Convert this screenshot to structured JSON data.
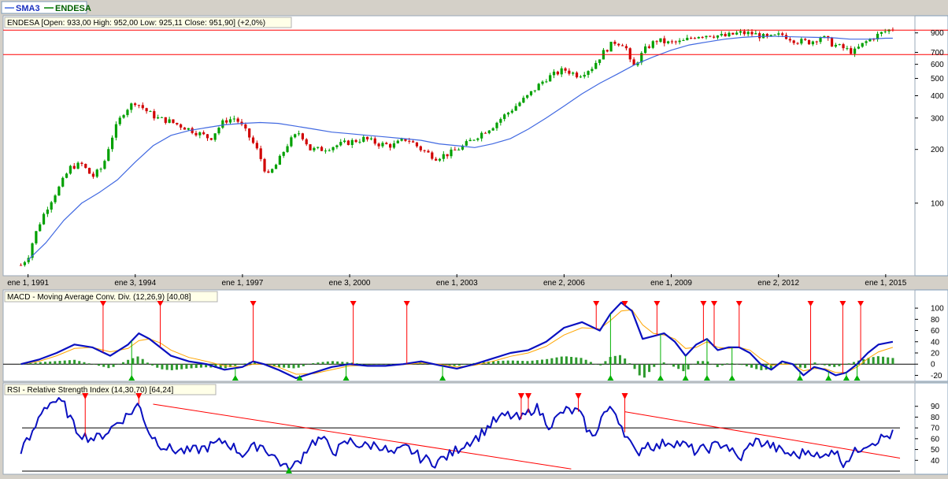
{
  "legend": {
    "items": [
      {
        "label": "SMA3",
        "color": "#4169e1"
      },
      {
        "label": "ENDESA",
        "color": "#008000"
      }
    ]
  },
  "colors": {
    "up": "#00a000",
    "down": "#d00000",
    "sma": "#4169e1",
    "macd_line": "#0a10c0",
    "signal_line": "#ffa500",
    "rsi_line": "#0a10c0",
    "trend_line": "#ff0000",
    "grid_border": "#7f9db9"
  },
  "price_panel": {
    "header": "ENDESA [Open: 933,00  High: 952,00  Low: 925,11  Close: 951,90] (+2,0%)",
    "scale": "log",
    "y_ticks": [
      "900",
      "700",
      "600",
      "500",
      "400",
      "300",
      "200",
      "100"
    ],
    "hlines": [
      933,
      680
    ],
    "x_ticks": [
      "ene 1, 1991",
      "ene 3, 1994",
      "ene 1, 1997",
      "ene 3, 2000",
      "ene 1, 2003",
      "ene 2, 2006",
      "ene 1, 2009",
      "ene 2, 2012",
      "ene 1, 2015"
    ]
  },
  "macd_panel": {
    "header": "MACD - Moving Average Conv. Div. (12,26,9) [40,08]",
    "y_ticks": [
      "100",
      "80",
      "60",
      "40",
      "20",
      "0",
      "-20"
    ]
  },
  "rsi_panel": {
    "header": "RSI - Relative Strength Index (14,30,70) [64,24]",
    "y_ticks": [
      "90",
      "80",
      "70",
      "60",
      "50",
      "40"
    ],
    "levels": [
      70,
      30
    ]
  },
  "chart_data": [
    {
      "type": "candlestick",
      "title": "ENDESA",
      "scale": "log",
      "x_range": [
        1990.7,
        2015.4
      ],
      "ylim": [
        40,
        1100
      ],
      "series": [
        {
          "name": "ENDESA",
          "kind": "close",
          "x": [
            1990.8,
            1991.0,
            1991.3,
            1991.6,
            1991.9,
            1992.2,
            1992.5,
            1992.8,
            1993.1,
            1993.4,
            1993.7,
            1994.0,
            1994.3,
            1994.6,
            1994.9,
            1995.3,
            1995.7,
            1996.1,
            1996.5,
            1996.8,
            1997.1,
            1997.4,
            1997.7,
            1998.0,
            1998.3,
            1998.6,
            1998.9,
            1999.2,
            1999.6,
            2000.0,
            2000.4,
            2000.8,
            2001.2,
            2001.6,
            2002.0,
            2002.4,
            2002.8,
            2003.2,
            2003.6,
            2004.0,
            2004.5,
            2005.0,
            2005.5,
            2006.0,
            2006.4,
            2006.8,
            2007.1,
            2007.4,
            2007.7,
            2007.9,
            2008.3,
            2008.6,
            2008.9,
            2009.3,
            2009.7,
            2010.1,
            2010.5,
            2010.9,
            2011.3,
            2011.7,
            2012.1,
            2012.5,
            2012.9,
            2013.2,
            2013.5,
            2013.8,
            2014.1,
            2014.4,
            2014.7,
            2015.0,
            2015.2
          ],
          "y": [
            45,
            50,
            75,
            100,
            125,
            160,
            165,
            140,
            160,
            250,
            330,
            370,
            330,
            300,
            290,
            270,
            250,
            230,
            290,
            300,
            250,
            200,
            140,
            170,
            220,
            250,
            200,
            200,
            210,
            220,
            230,
            215,
            210,
            230,
            200,
            180,
            190,
            210,
            240,
            270,
            330,
            400,
            500,
            560,
            520,
            580,
            700,
            800,
            780,
            560,
            740,
            820,
            790,
            800,
            870,
            880,
            860,
            900,
            890,
            840,
            880,
            810,
            800,
            860,
            780,
            740,
            700,
            790,
            860,
            920,
            950
          ]
        },
        {
          "name": "SMA3",
          "kind": "sma",
          "x": [
            1991.0,
            1991.5,
            1992.0,
            1992.5,
            1993.0,
            1993.5,
            1994.0,
            1994.5,
            1995.0,
            1995.5,
            1996.0,
            1996.5,
            1997.0,
            1997.5,
            1998.0,
            1998.5,
            1999.0,
            1999.5,
            2000.0,
            2000.5,
            2001.0,
            2001.5,
            2002.0,
            2002.5,
            2003.0,
            2003.5,
            2004.0,
            2004.5,
            2005.0,
            2005.5,
            2006.0,
            2006.5,
            2007.0,
            2007.5,
            2008.0,
            2008.5,
            2009.0,
            2009.5,
            2010.0,
            2010.5,
            2011.0,
            2011.5,
            2012.0,
            2012.5,
            2013.0,
            2013.5,
            2014.0,
            2014.5,
            2015.0,
            2015.2
          ],
          "y": [
            48,
            60,
            80,
            100,
            115,
            135,
            170,
            210,
            240,
            255,
            265,
            275,
            280,
            283,
            280,
            270,
            260,
            250,
            245,
            240,
            235,
            230,
            225,
            215,
            210,
            205,
            215,
            230,
            260,
            300,
            350,
            410,
            470,
            530,
            600,
            660,
            720,
            770,
            800,
            830,
            850,
            860,
            860,
            855,
            850,
            845,
            830,
            830,
            840,
            840
          ]
        }
      ]
    },
    {
      "type": "line",
      "title": "MACD - Moving Average Conv. Div. (12,26,9)",
      "ylim": [
        -25,
        110
      ],
      "x": [
        1990.8,
        1991.3,
        1991.8,
        1992.3,
        1992.8,
        1993.3,
        1993.8,
        1994.1,
        1994.4,
        1994.7,
        1995.0,
        1995.5,
        1996.0,
        1996.5,
        1997.0,
        1997.3,
        1997.6,
        1998.0,
        1998.5,
        1999.0,
        1999.5,
        2000.0,
        2000.5,
        2001.0,
        2001.5,
        2002.0,
        2002.5,
        2003.0,
        2003.5,
        2004.0,
        2004.5,
        2005.0,
        2005.5,
        2006.0,
        2006.5,
        2007.0,
        2007.3,
        2007.6,
        2007.9,
        2008.2,
        2008.5,
        2008.8,
        2009.1,
        2009.4,
        2009.7,
        2010.0,
        2010.3,
        2010.6,
        2010.9,
        2011.2,
        2011.5,
        2011.8,
        2012.1,
        2012.4,
        2012.7,
        2013.0,
        2013.3,
        2013.6,
        2013.9,
        2014.2,
        2014.5,
        2014.8,
        2015.2
      ],
      "series": [
        {
          "name": "MACD",
          "values": [
            0,
            8,
            20,
            35,
            30,
            15,
            35,
            55,
            45,
            30,
            15,
            5,
            0,
            -10,
            -5,
            5,
            0,
            -10,
            -25,
            -15,
            -5,
            0,
            -3,
            -3,
            0,
            5,
            -2,
            -8,
            0,
            10,
            20,
            25,
            40,
            65,
            75,
            60,
            90,
            110,
            95,
            45,
            50,
            55,
            40,
            15,
            35,
            45,
            25,
            30,
            30,
            20,
            0,
            -10,
            5,
            0,
            -20,
            -5,
            -10,
            -20,
            -15,
            0,
            20,
            35,
            40
          ]
        },
        {
          "name": "Signal",
          "values": [
            0,
            5,
            15,
            28,
            30,
            22,
            28,
            42,
            45,
            38,
            25,
            12,
            5,
            -3,
            -5,
            0,
            0,
            -5,
            -18,
            -17,
            -10,
            -3,
            -2,
            -3,
            -1,
            2,
            0,
            -5,
            -2,
            5,
            14,
            20,
            32,
            52,
            65,
            63,
            78,
            95,
            97,
            70,
            55,
            52,
            45,
            28,
            30,
            40,
            30,
            28,
            30,
            25,
            10,
            -2,
            0,
            0,
            -12,
            -8,
            -8,
            -15,
            -15,
            -5,
            10,
            22,
            30
          ]
        }
      ]
    },
    {
      "type": "line",
      "title": "RSI - Relative Strength Index (14,30,70)",
      "ylim": [
        30,
        100
      ],
      "x": [
        1990.8,
        1991.1,
        1991.4,
        1991.7,
        1992.0,
        1992.3,
        1992.6,
        1992.9,
        1993.2,
        1993.5,
        1993.8,
        1994.1,
        1994.4,
        1994.7,
        1995.0,
        1995.5,
        1996.0,
        1996.5,
        1997.0,
        1997.5,
        1998.0,
        1998.3,
        1998.6,
        1998.9,
        1999.2,
        1999.6,
        2000.0,
        2000.4,
        2000.8,
        2001.2,
        2001.6,
        2002.0,
        2002.4,
        2002.8,
        2003.2,
        2003.6,
        2004.0,
        2004.4,
        2004.8,
        2005.2,
        2005.6,
        2006.0,
        2006.4,
        2006.8,
        2007.1,
        2007.4,
        2007.7,
        2008.0,
        2008.3,
        2008.6,
        2008.9,
        2009.3,
        2009.7,
        2010.1,
        2010.5,
        2010.9,
        2011.3,
        2011.7,
        2012.1,
        2012.5,
        2012.9,
        2013.2,
        2013.5,
        2013.8,
        2014.1,
        2014.4,
        2014.7,
        2015.0,
        2015.2
      ],
      "series": [
        {
          "name": "RSI",
          "values": [
            50,
            62,
            88,
            95,
            92,
            70,
            62,
            60,
            66,
            75,
            82,
            92,
            65,
            55,
            50,
            48,
            52,
            58,
            46,
            55,
            40,
            30,
            40,
            56,
            60,
            48,
            58,
            53,
            55,
            45,
            52,
            42,
            38,
            45,
            55,
            62,
            75,
            82,
            78,
            90,
            72,
            86,
            85,
            60,
            84,
            87,
            66,
            45,
            56,
            52,
            58,
            55,
            48,
            52,
            56,
            40,
            58,
            55,
            48,
            44,
            50,
            40,
            52,
            38,
            46,
            55,
            58,
            62,
            64
          ]
        }
      ]
    }
  ]
}
